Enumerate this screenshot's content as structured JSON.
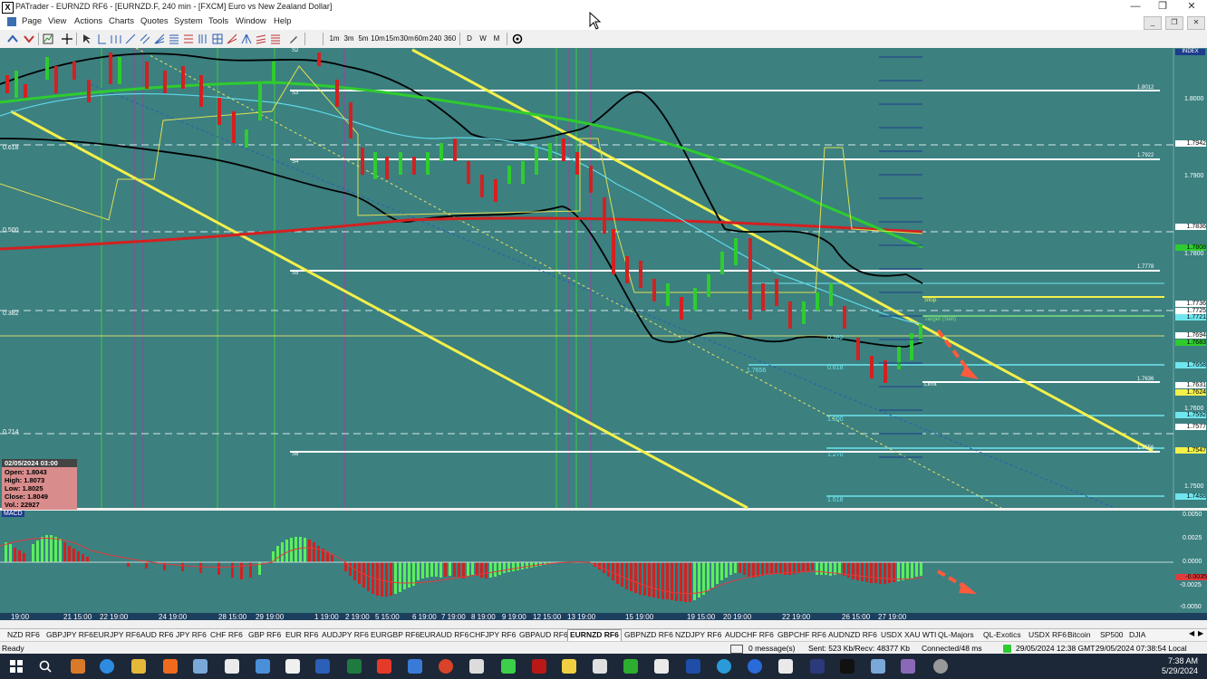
{
  "window": {
    "title": "PATrader - EURNZD RF6 - [EURNZD.F, 240 min - [FXCM] Euro vs New Zealand Dollar]",
    "app_icon_letter": "X"
  },
  "menu": [
    "Page",
    "View",
    "Actions",
    "Charts",
    "Quotes",
    "System",
    "Tools",
    "Window",
    "Help"
  ],
  "toolbar": {
    "timeframes": [
      "1m",
      "3m",
      "5m",
      "10m",
      "15m",
      "30m",
      "60m",
      "240",
      "360",
      "D",
      "W",
      "M"
    ]
  },
  "chart": {
    "index_label": "INDEX",
    "price_labels": [
      {
        "v": "1.8000",
        "style": "plain"
      },
      {
        "v": "1.7942",
        "style": "white"
      },
      {
        "v": "1.7900",
        "style": "plain"
      },
      {
        "v": "1.7836",
        "style": "white"
      },
      {
        "v": "1.7808",
        "style": "green"
      },
      {
        "v": "1.7800",
        "style": "plain"
      },
      {
        "v": "1.7736",
        "style": "white"
      },
      {
        "v": "1.7725",
        "style": "white"
      },
      {
        "v": "1.7721",
        "style": "cyan"
      },
      {
        "v": "1.7694",
        "style": "white"
      },
      {
        "v": "1.7683",
        "style": "green"
      },
      {
        "v": "1.7658",
        "style": "cyan"
      },
      {
        "v": "1.7631",
        "style": "white"
      },
      {
        "v": "1.7624",
        "style": "yellow"
      },
      {
        "v": "1.7600",
        "style": "plain"
      },
      {
        "v": "1.7592",
        "style": "cyan"
      },
      {
        "v": "1.7577",
        "style": "white"
      },
      {
        "v": "1.7547",
        "style": "yellow"
      },
      {
        "v": "1.7500",
        "style": "plain"
      },
      {
        "v": "1.7488",
        "style": "cyan"
      }
    ],
    "fib_left": [
      "0.618",
      "0.500",
      "0.382",
      "0.214"
    ],
    "level_tags": [
      "S2",
      "S3",
      "S4",
      "S5",
      "S6"
    ],
    "level_values": [
      "1.8012",
      "1.7922",
      "1.7778",
      "1.7636",
      "1.7556"
    ],
    "fib_right": [
      "1.000",
      "1.270",
      "1.618",
      "0.618",
      "0.382"
    ],
    "annotations": {
      "stop": "Stop",
      "target": "Target (Sell)",
      "limit": "Limit",
      "low_mark": "1.7656"
    },
    "dates": [
      "19:00",
      "21 15:00",
      "22 19:00",
      "24 19:00",
      "28 15:00",
      "29 19:00",
      "1 19:00",
      "2 19:00",
      "5 15:00",
      "6 19:00",
      "7 19:00",
      "8 19:00",
      "9 19:00",
      "12 15:00",
      "13 19:00",
      "15 19:00",
      "19 15:00",
      "20 19:00",
      "22 19:00",
      "26 15:00",
      "27 19:00"
    ],
    "ohlc": {
      "date": "02/05/2024 03:00",
      "open": "Open: 1.8043",
      "high": "High: 1.8073",
      "low": "Low: 1.8025",
      "close": "Close: 1.8049",
      "vol": "Vol.: 22927"
    }
  },
  "macd": {
    "label": "MACD",
    "axis": [
      "0.0050",
      "0.0025",
      "0.0000",
      "-0.0025",
      "-0.0050"
    ],
    "current": "-0.0035"
  },
  "tabs": [
    "NZD RF6",
    "GBPJPY RF6",
    "EURJPY RF6",
    "AUD RF6",
    "JPY RF6",
    "CHF RF6",
    "GBP RF6",
    "EUR RF6",
    "AUDJPY RF6",
    "EURGBP RF6",
    "EURAUD RF6",
    "CHFJPY RF6",
    "GBPAUD RF6",
    "EURNZD RF6",
    "GBPNZD RF6",
    "NZDJPY RF6",
    "AUDCHF RF6",
    "GBPCHF RF6",
    "AUDNZD RF6",
    "USDX XAU WTI",
    "QL-Majors",
    "QL-Exotics",
    "USDX RF6",
    "Bitcoin",
    "SP500",
    "DJIA"
  ],
  "active_tab": "EURNZD RF6",
  "status": {
    "ready": "Ready",
    "messages": "0 message(s)",
    "traffic": "Sent: 523 Kb/Recv: 48377 Kb",
    "connection": "Connected/48 ms",
    "server_time": "29/05/2024 12:38 GMT",
    "local_time": "29/05/2024 07:38:54 Local"
  },
  "taskbar": {
    "time": "7:38 AM",
    "date": "5/29/2024"
  }
}
